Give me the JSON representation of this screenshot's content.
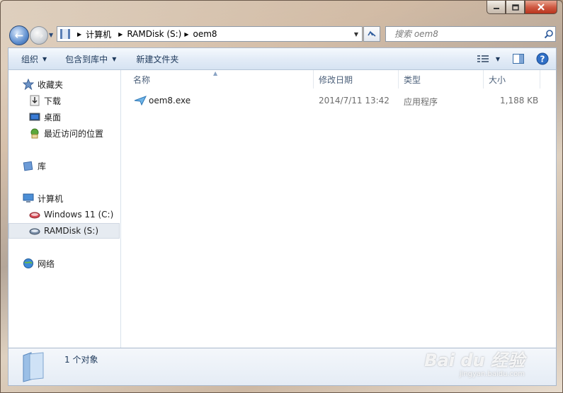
{
  "window": {
    "caption": {
      "minimize": "minimize-icon",
      "maximize": "maximize-icon",
      "close": "close-icon"
    }
  },
  "address": {
    "crumbs": [
      "计算机",
      "RAMDisk (S:)",
      "oem8"
    ]
  },
  "search": {
    "placeholder": "搜索 oem8"
  },
  "toolbar": {
    "organize": "组织",
    "include_in_library": "包含到库中",
    "new_folder": "新建文件夹"
  },
  "navpane": {
    "favorites": "收藏夹",
    "downloads": "下载",
    "desktop": "桌面",
    "recent": "最近访问的位置",
    "libraries": "库",
    "computer": "计算机",
    "drive_c": "Windows 11 (C:)",
    "drive_s": "RAMDisk (S:)",
    "network": "网络"
  },
  "columns": {
    "name": "名称",
    "modified": "修改日期",
    "type": "类型",
    "size": "大小"
  },
  "files": [
    {
      "name": "oem8.exe",
      "modified": "2014/7/11 13:42",
      "type": "应用程序",
      "size": "1,188 KB"
    }
  ],
  "details": {
    "count_text": "1 个对象"
  },
  "watermark": {
    "brand": "Bai du 经验",
    "url": "jingyan.baidu.com"
  },
  "colors": {
    "accent": "#2e5b9c",
    "toolbar_text": "#1e395b"
  }
}
